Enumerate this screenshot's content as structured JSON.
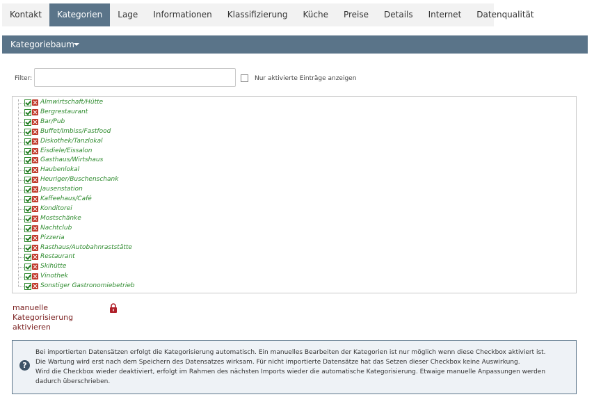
{
  "tabs": [
    {
      "label": "Kontakt",
      "active": false
    },
    {
      "label": "Kategorien",
      "active": true
    },
    {
      "label": "Lage",
      "active": false
    },
    {
      "label": "Informationen",
      "active": false
    },
    {
      "label": "Klassifizierung",
      "active": false
    },
    {
      "label": "Küche",
      "active": false
    },
    {
      "label": "Preise",
      "active": false
    },
    {
      "label": "Details",
      "active": false
    },
    {
      "label": "Internet",
      "active": false
    },
    {
      "label": "Datenqualität",
      "active": false
    }
  ],
  "section": {
    "title": "Kategoriebaum",
    "icon": "caret-down-icon"
  },
  "filter": {
    "label": "Filter:",
    "value": "",
    "checkbox_label": "Nur aktivierte Einträge anzeigen",
    "checkbox_checked": false
  },
  "tree": {
    "items": [
      "Almwirtschaft/Hütte",
      "Bergrestaurant",
      "Bar/Pub",
      "Buffet/Imbiss/Fastfood",
      "Diskothek/Tanzlokal",
      "Eisdiele/Eissalon",
      "Gasthaus/Wirtshaus",
      "Haubenlokal",
      "Heuriger/Buschenschank",
      "Jausenstation",
      "Kaffeehaus/Café",
      "Konditorei",
      "Mostschänke",
      "Nachtclub",
      "Pizzeria",
      "Rasthaus/Autobahnraststätte",
      "Restaurant",
      "Skihütte",
      "Vinothek",
      "Sonstiger Gastronomiebetrieb"
    ],
    "checked": true,
    "item_color": "#2e8b2e"
  },
  "manual": {
    "label": "manuelle Kategorisierung aktivieren",
    "icon": "lock-icon",
    "lock_color": "#b0202a"
  },
  "info": {
    "icon": "question-circle-icon",
    "lines": [
      "Bei importierten Datensätzen erfolgt die Kategorisierung automatisch. Ein manuelles Bearbeiten der Kategorien ist nur möglich wenn diese Checkbox aktiviert ist.",
      "Die Wartung wird erst nach dem Speichern des Datensatzes wirksam. Für nicht importierte Datensätze hat das Setzen dieser Checkbox keine Auswirkung.",
      "Wird die Checkbox wieder deaktiviert, erfolgt im Rahmen des nächsten Imports wieder die automatische Kategorisierung. Etwaige manuelle Anpassungen werden dadurch überschrieben."
    ]
  },
  "colors": {
    "accent": "#5a7489",
    "tab_bg": "#f2f2f2"
  }
}
